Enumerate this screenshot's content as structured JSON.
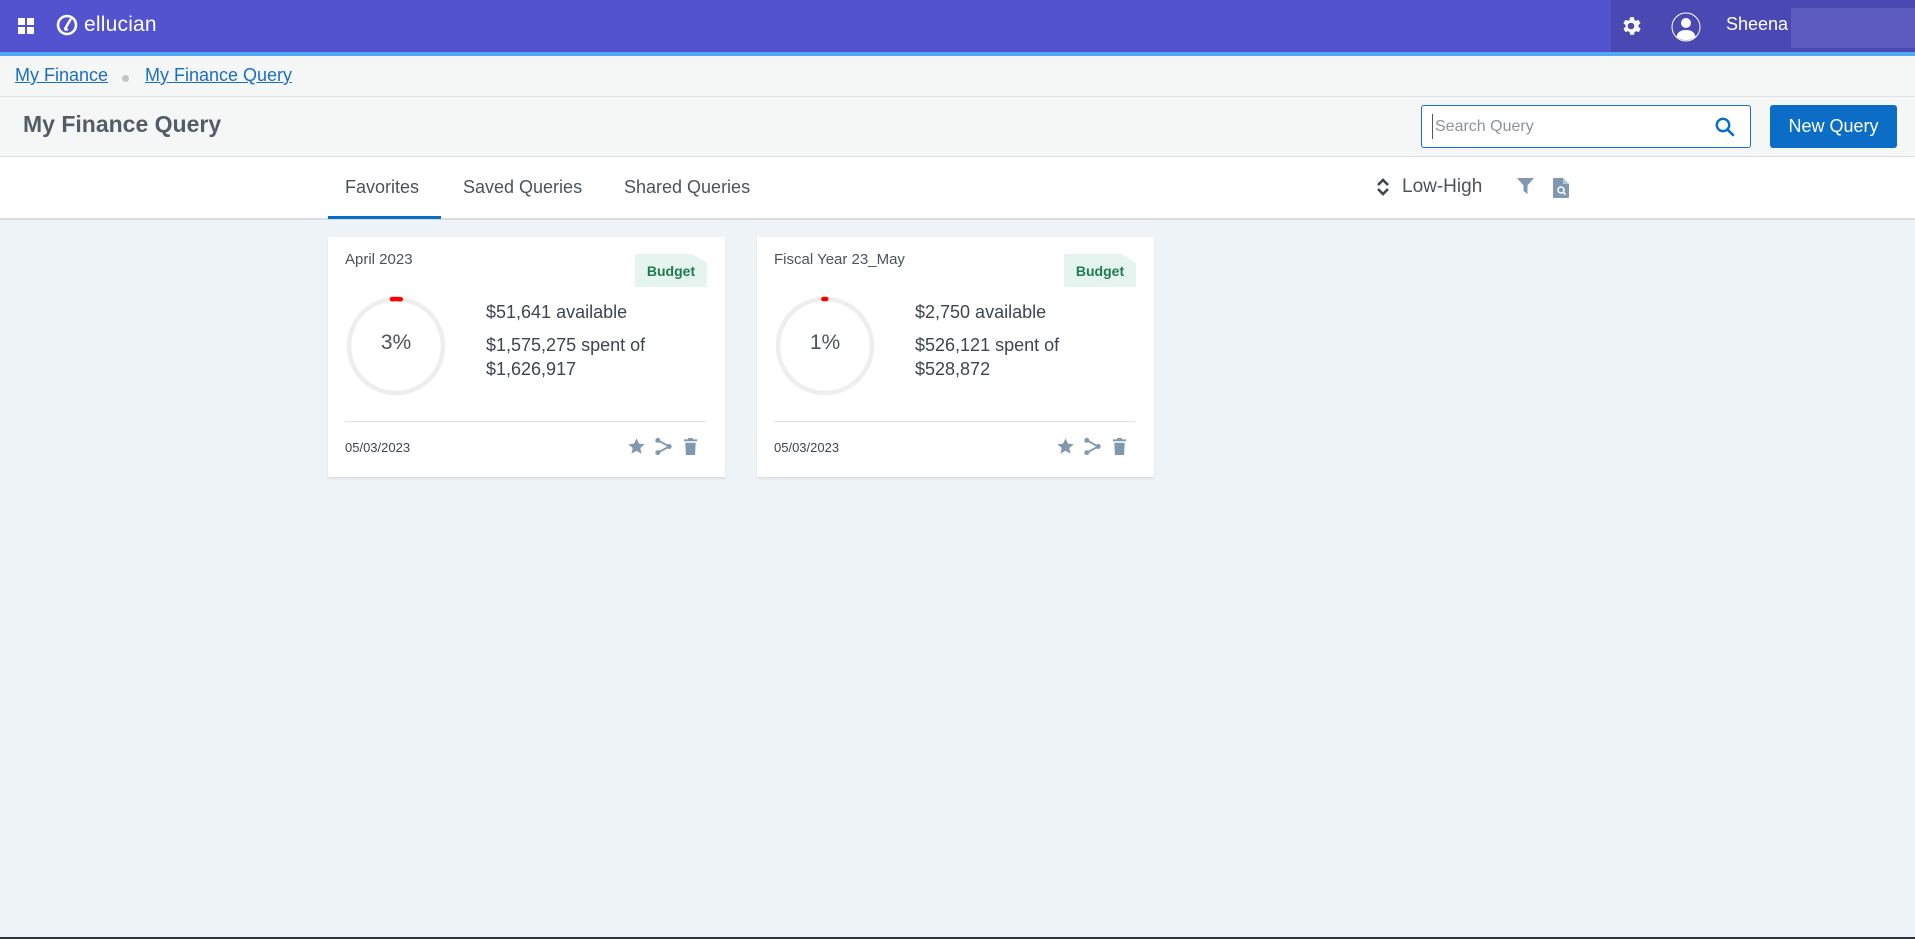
{
  "header": {
    "brand": "ellucian",
    "user_name": "Sheena",
    "apps_icon": "grid-icon",
    "settings_icon": "gear-icon",
    "avatar_icon": "user-avatar-icon",
    "colors": {
      "primary": "#5353d0",
      "accent_stripe": "#4fa9f5",
      "user_area": "#4a49b4"
    }
  },
  "breadcrumb": [
    {
      "label": "My Finance"
    },
    {
      "label": "My Finance Query"
    }
  ],
  "page": {
    "title": "My Finance Query",
    "search": {
      "placeholder": "Search Query",
      "value": ""
    },
    "new_query_label": "New Query",
    "button_color": "#0b6dc6"
  },
  "tabs": [
    {
      "label": "Favorites",
      "active": true
    },
    {
      "label": "Saved Queries",
      "active": false
    },
    {
      "label": "Shared Queries",
      "active": false
    }
  ],
  "toolbar": {
    "sort_label": "Low-High",
    "sort_icon": "sort-updown-icon",
    "filter_icon": "filter-icon",
    "preview_icon": "document-search-icon"
  },
  "cards": [
    {
      "title": "April 2023",
      "tag": "Budget",
      "percent": 3,
      "percent_label": "3%",
      "available": "$51,641 available",
      "spent": "$1,575,275 spent of $1,626,917",
      "date": "05/03/2023",
      "actions": [
        "star-icon",
        "share-icon",
        "trash-icon"
      ]
    },
    {
      "title": "Fiscal Year 23_May",
      "tag": "Budget",
      "percent": 1,
      "percent_label": "1%",
      "available": "$2,750 available",
      "spent": "$526,121 spent of $528,872",
      "date": "05/03/2023",
      "actions": [
        "star-icon",
        "share-icon",
        "trash-icon"
      ]
    }
  ],
  "colors": {
    "ring_track": "#eeeeee",
    "ring_fill": "#ff0000",
    "tag_bg": "#e6f4ef",
    "tag_text": "#1e7b4f",
    "icon_gray": "#8199b0"
  }
}
